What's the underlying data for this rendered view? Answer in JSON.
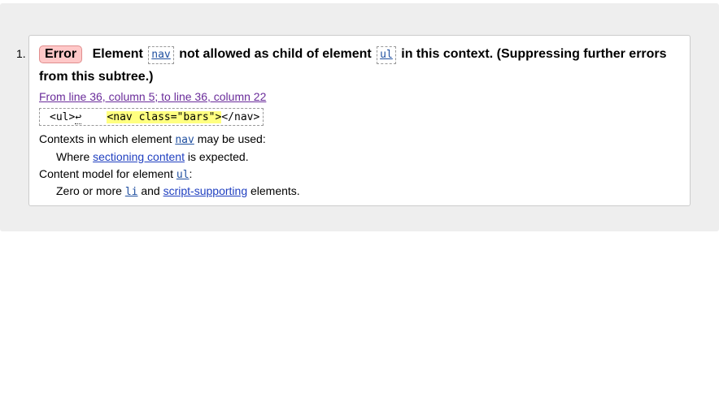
{
  "message": {
    "number": "1.",
    "type": "Error",
    "text_element": "Element",
    "element_name": "nav",
    "text_mid": "not allowed as child of element",
    "parent_name": "ul",
    "text_end": "in this context. (Suppressing further errors from this subtree.)",
    "location": "From line 36, column 5; to line 36, column 22",
    "extract_before": "<ul>",
    "extract_newline": "↩",
    "extract_gap": "    ",
    "extract_highlight": "<nav class=\"bars\">",
    "extract_after": "</nav>"
  },
  "contexts": {
    "label_start": "Contexts in which element",
    "element": "nav",
    "label_end": "may be used:",
    "item_start": "Where",
    "item_link": "sectioning content",
    "item_end": "is expected."
  },
  "content_model": {
    "label_start": "Content model for element",
    "element": "ul",
    "label_end": ":",
    "item_start": "Zero or more",
    "item_code": "li",
    "item_mid": "and",
    "item_link": "script-supporting",
    "item_end": "elements."
  }
}
